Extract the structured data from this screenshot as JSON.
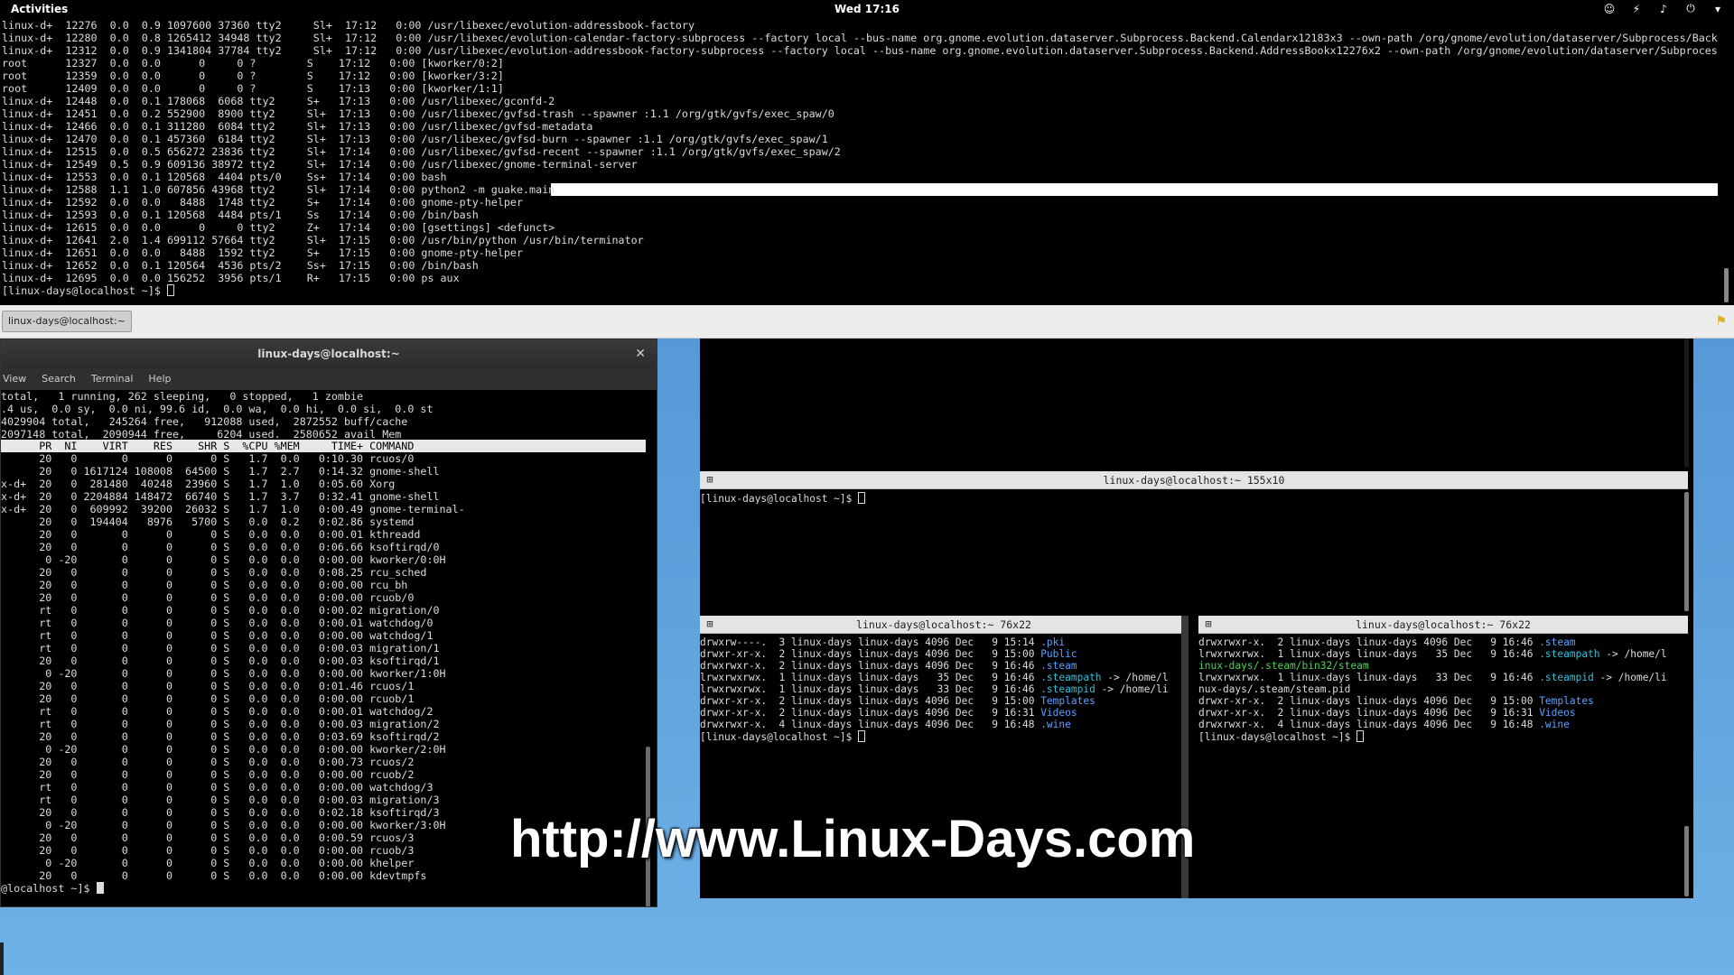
{
  "topbar": {
    "activities": "Activities",
    "clock": "Wed 17:16",
    "tray": [
      "people-icon",
      "network-icon",
      "volume-icon",
      "power-icon",
      "chevron-down-icon"
    ]
  },
  "guake": {
    "lines": [
      "linux-d+  12276  0.0  0.9 1097600 37360 tty2     Sl+  17:12   0:00 /usr/libexec/evolution-addressbook-factory",
      "linux-d+  12280  0.0  0.8 1265412 34948 tty2     Sl+  17:12   0:00 /usr/libexec/evolution-calendar-factory-subprocess --factory local --bus-name org.gnome.evolution.dataserver.Subprocess.Backend.Calendarx12183x3 --own-path /org/gnome/evolution/dataserver/Subprocess/Backend",
      "linux-d+  12312  0.0  0.9 1341804 37784 tty2     Sl+  17:12   0:00 /usr/libexec/evolution-addressbook-factory-subprocess --factory local --bus-name org.gnome.evolution.dataserver.Subprocess.Backend.AddressBookx12276x2 --own-path /org/gnome/evolution/dataserver/Subprocess/B",
      "root      12327  0.0  0.0      0     0 ?        S    17:12   0:00 [kworker/0:2]",
      "root      12359  0.0  0.0      0     0 ?        S    17:12   0:00 [kworker/3:2]",
      "root      12409  0.0  0.0      0     0 ?        S    17:13   0:00 [kworker/1:1]",
      "linux-d+  12448  0.0  0.1 178068  6068 tty2     S+   17:13   0:00 /usr/libexec/gconfd-2",
      "linux-d+  12451  0.0  0.2 552900  8900 tty2     Sl+  17:13   0:00 /usr/libexec/gvfsd-trash --spawner :1.1 /org/gtk/gvfs/exec_spaw/0",
      "linux-d+  12466  0.0  0.1 311280  6084 tty2     Sl+  17:13   0:00 /usr/libexec/gvfsd-metadata",
      "linux-d+  12470  0.0  0.1 457360  6184 tty2     Sl+  17:13   0:00 /usr/libexec/gvfsd-burn --spawner :1.1 /org/gtk/gvfs/exec_spaw/1",
      "linux-d+  12515  0.0  0.5 656272 23836 tty2     Sl+  17:14   0:00 /usr/libexec/gvfsd-recent --spawner :1.1 /org/gtk/gvfs/exec_spaw/2",
      "linux-d+  12549  0.5  0.9 609136 38972 tty2     Sl+  17:14   0:00 /usr/libexec/gnome-terminal-server",
      "linux-d+  12553  0.0  0.1 120568  4404 pts/0    Ss+  17:14   0:00 bash",
      "linux-d+  12588  1.1  1.0 607856 43968 tty2     Sl+  17:14   0:00 python2 -m guake.main",
      "linux-d+  12592  0.0  0.0   8488  1748 tty2     S+   17:14   0:00 gnome-pty-helper",
      "linux-d+  12593  0.0  0.1 120568  4484 pts/1    Ss   17:14   0:00 /bin/bash",
      "linux-d+  12615  0.0  0.0      0     0 tty2     Z+   17:14   0:00 [gsettings] <defunct>",
      "linux-d+  12641  2.0  1.4 699112 57664 tty2     Sl+  17:15   0:00 /usr/bin/python /usr/bin/terminator",
      "linux-d+  12651  0.0  0.0   8488  1592 tty2     S+   17:15   0:00 gnome-pty-helper",
      "linux-d+  12652  0.0  0.1 120564  4536 pts/2    Ss+  17:15   0:00 /bin/bash",
      "linux-d+  12695  0.0  0.0 156252  3956 pts/1    R+   17:15   0:00 ps aux"
    ],
    "prompt": "[linux-days@localhost ~]$ ",
    "tab_label": "linux-days@localhost:~"
  },
  "top_window": {
    "title": "linux-days@localhost:~",
    "menu": [
      "View",
      "Search",
      "Terminal",
      "Help"
    ],
    "summary": [
      "total,   1 running, 262 sleeping,   0 stopped,   1 zombie",
      ".4 us,  0.0 sy,  0.0 ni, 99.6 id,  0.0 wa,  0.0 hi,  0.0 si,  0.0 st",
      "4029904 total,   245264 free,   912088 used,  2872552 buff/cache",
      "2097148 total,  2090944 free,     6204 used.  2580652 avail Mem"
    ],
    "header": "      PR  NI    VIRT    RES    SHR S  %CPU %MEM     TIME+ COMMAND",
    "rows": [
      "      20   0       0      0      0 S   1.7  0.0   0:10.30 rcuos/0",
      "      20   0 1617124 108008  64500 S   1.7  2.7   0:14.32 gnome-shell",
      "x-d+  20   0  281480  40248  23960 S   1.7  1.0   0:05.60 Xorg",
      "x-d+  20   0 2204884 148472  66740 S   1.7  3.7   0:32.41 gnome-shell",
      "x-d+  20   0  609992  39200  26032 S   1.7  1.0   0:00.49 gnome-terminal-",
      "      20   0  194404   8976   5700 S   0.0  0.2   0:02.86 systemd",
      "      20   0       0      0      0 S   0.0  0.0   0:00.01 kthreadd",
      "      20   0       0      0      0 S   0.0  0.0   0:06.66 ksoftirqd/0",
      "       0 -20       0      0      0 S   0.0  0.0   0:00.00 kworker/0:0H",
      "      20   0       0      0      0 S   0.0  0.0   0:08.25 rcu_sched",
      "      20   0       0      0      0 S   0.0  0.0   0:00.00 rcu_bh",
      "      20   0       0      0      0 S   0.0  0.0   0:00.00 rcuob/0",
      "      rt   0       0      0      0 S   0.0  0.0   0:00.02 migration/0",
      "      rt   0       0      0      0 S   0.0  0.0   0:00.01 watchdog/0",
      "      rt   0       0      0      0 S   0.0  0.0   0:00.00 watchdog/1",
      "      rt   0       0      0      0 S   0.0  0.0   0:00.03 migration/1",
      "      20   0       0      0      0 S   0.0  0.0   0:00.03 ksoftirqd/1",
      "       0 -20       0      0      0 S   0.0  0.0   0:00.00 kworker/1:0H",
      "      20   0       0      0      0 S   0.0  0.0   0:01.46 rcuos/1",
      "      20   0       0      0      0 S   0.0  0.0   0:00.00 rcuob/1",
      "      rt   0       0      0      0 S   0.0  0.0   0:00.01 watchdog/2",
      "      rt   0       0      0      0 S   0.0  0.0   0:00.03 migration/2",
      "      20   0       0      0      0 S   0.0  0.0   0:03.69 ksoftirqd/2",
      "       0 -20       0      0      0 S   0.0  0.0   0:00.00 kworker/2:0H",
      "      20   0       0      0      0 S   0.0  0.0   0:00.73 rcuos/2",
      "      20   0       0      0      0 S   0.0  0.0   0:00.00 rcuob/2",
      "      rt   0       0      0      0 S   0.0  0.0   0:00.00 watchdog/3",
      "      rt   0       0      0      0 S   0.0  0.0   0:00.03 migration/3",
      "      20   0       0      0      0 S   0.0  0.0   0:02.18 ksoftirqd/3",
      "       0 -20       0      0      0 S   0.0  0.0   0:00.00 kworker/3:0H",
      "      20   0       0      0      0 S   0.0  0.0   0:00.59 rcuos/3",
      "      20   0       0      0      0 S   0.0  0.0   0:00.00 rcuob/3",
      "       0 -20       0      0      0 S   0.0  0.0   0:00.00 khelper",
      "      20   0       0      0      0 S   0.0  0.0   0:00.00 kdevtmpfs"
    ],
    "prompt": "@localhost ~]$ "
  },
  "split_window": {
    "top_pane_title": "linux-days@localhost:~ 155x10",
    "middle_pane_title": "linux-days@localhost:~ 155x10",
    "middle_prompt": "[linux-days@localhost ~]$ ",
    "left_pane_title": "linux-days@localhost:~ 76x22",
    "right_pane_title": "linux-days@localhost:~ 76x22",
    "left_lines": [
      {
        "pre": "drwxrw----.  3 linux-days linux-days 4096 Dec   9 15:14 ",
        "name": ".pki",
        "color": "blue"
      },
      {
        "pre": "drwxr-xr-x.  2 linux-days linux-days 4096 Dec   9 15:00 ",
        "name": "Public",
        "color": "blue"
      },
      {
        "pre": "drwxrwxr-x.  2 linux-days linux-days 4096 Dec   9 16:46 ",
        "name": ".steam",
        "color": "blue"
      },
      {
        "pre": "lrwxrwxrwx.  1 linux-days linux-days   35 Dec   9 16:46 ",
        "name": ".steampath",
        "color": "cyan",
        "post": " -> /home/l"
      },
      {
        "pre": "lrwxrwxrwx.  1 linux-days linux-days   33 Dec   9 16:46 ",
        "name": ".steampid",
        "color": "cyan",
        "post": " -> /home/li"
      },
      {
        "pre": "drwxr-xr-x.  2 linux-days linux-days 4096 Dec   9 15:00 ",
        "name": "Templates",
        "color": "blue"
      },
      {
        "pre": "drwxr-xr-x.  2 linux-days linux-days 4096 Dec   9 16:31 ",
        "name": "Videos",
        "color": "blue"
      },
      {
        "pre": "drwxrwxr-x.  4 linux-days linux-days 4096 Dec   9 16:48 ",
        "name": ".wine",
        "color": "blue"
      }
    ],
    "right_lines": [
      {
        "pre": "drwxrwxr-x.  2 linux-days linux-days 4096 Dec   9 16:46 ",
        "name": ".steam",
        "color": "blue"
      },
      {
        "pre": "lrwxrwxrwx.  1 linux-days linux-days   35 Dec   9 16:46 ",
        "name": ".steampath",
        "color": "cyan",
        "post": " -> /home/l"
      },
      {
        "pre": "",
        "name": "inux-days/.steam/bin32/steam",
        "color": "grn"
      },
      {
        "pre": "lrwxrwxrwx.  1 linux-days linux-days   33 Dec   9 16:46 ",
        "name": ".steampid",
        "color": "cyan",
        "post": " -> /home/li"
      },
      {
        "pre": "nux-days/.steam/steam.pid",
        "name": "",
        "color": "grn"
      },
      {
        "pre": "drwxr-xr-x.  2 linux-days linux-days 4096 Dec   9 15:00 ",
        "name": "Templates",
        "color": "blue"
      },
      {
        "pre": "drwxr-xr-x.  2 linux-days linux-days 4096 Dec   9 16:31 ",
        "name": "Videos",
        "color": "blue"
      },
      {
        "pre": "drwxrwxr-x.  4 linux-days linux-days 4096 Dec   9 16:48 ",
        "name": ".wine",
        "color": "blue"
      }
    ],
    "prompt": "[linux-days@localhost ~]$ "
  },
  "watermark": "http://www.Linux-Days.com"
}
